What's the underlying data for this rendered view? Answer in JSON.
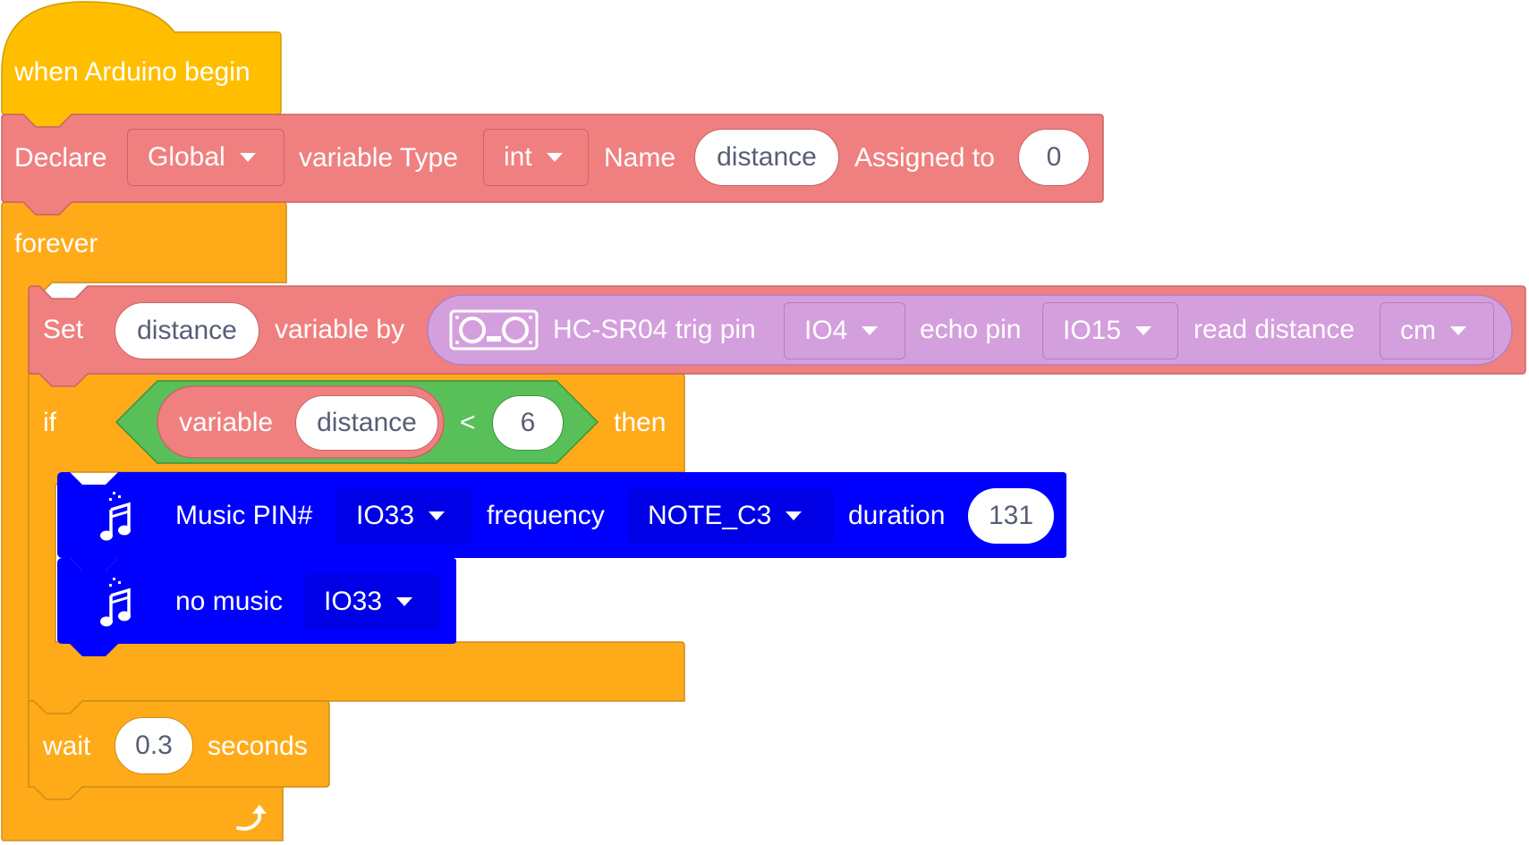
{
  "colors": {
    "events": "#ffbf00",
    "variables": "#f08080",
    "control": "#ffab19",
    "sensor": "#d49fdd",
    "operator": "#59c059",
    "music": "#0000ff",
    "input_text": "#575e75"
  },
  "hat": {
    "label": "when Arduino begin"
  },
  "declare": {
    "label": "Declare",
    "scope": "Global",
    "type_label": "variable Type",
    "type_value": "int",
    "name_label": "Name",
    "name_value": "distance",
    "assigned_label": "Assigned to",
    "assigned_value": "0"
  },
  "forever": {
    "label": "forever",
    "loop_icon": "loop-arrow-icon"
  },
  "set": {
    "label": "Set",
    "variable": "distance",
    "by_label": "variable by",
    "sensor": {
      "icon": "ultrasonic-sensor-icon",
      "trig_label": "HC-SR04 trig pin",
      "trig_value": "IO4",
      "echo_label": "echo pin",
      "echo_value": "IO15",
      "read_label": "read distance",
      "unit_value": "cm"
    }
  },
  "if_block": {
    "if_label": "if",
    "then_label": "then",
    "condition": {
      "var_label": "variable",
      "var_value": "distance",
      "operator": "<",
      "compare_value": "6"
    }
  },
  "music": {
    "icon": "music-note-icon",
    "pin_label": "Music PIN#",
    "pin_value": "IO33",
    "freq_label": "frequency",
    "freq_value": "NOTE_C3",
    "duration_label": "duration",
    "duration_value": "131"
  },
  "no_music": {
    "icon": "music-note-icon",
    "label": "no music",
    "pin_value": "IO33"
  },
  "wait": {
    "label": "wait",
    "value": "0.3",
    "unit_label": "seconds"
  }
}
